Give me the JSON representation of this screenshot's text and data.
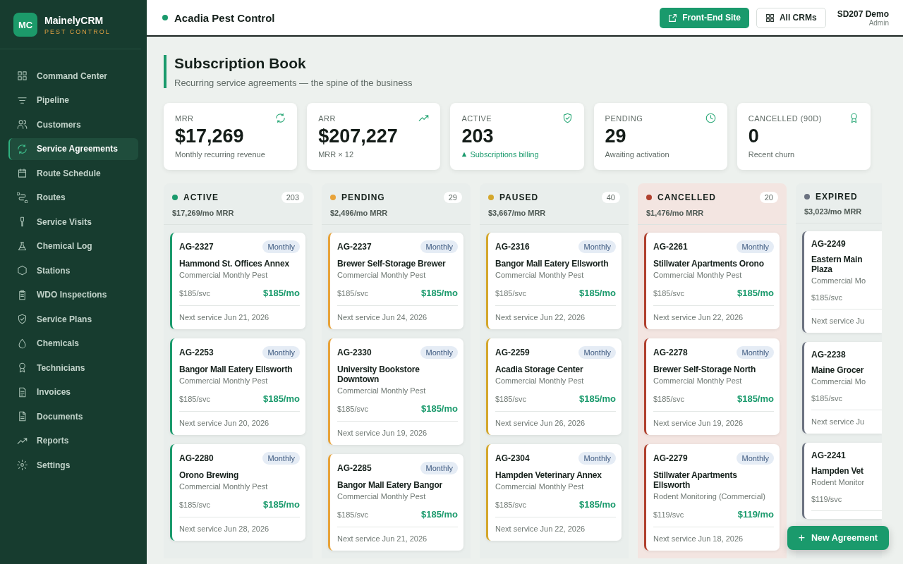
{
  "brand": {
    "logo": "MC",
    "name": "MainelyCRM",
    "tagline": "PEST CONTROL"
  },
  "sidebar": {
    "items": [
      {
        "label": "Command Center",
        "selected": false
      },
      {
        "label": "Pipeline",
        "selected": false
      },
      {
        "label": "Customers",
        "selected": false
      },
      {
        "label": "Service Agreements",
        "selected": true
      },
      {
        "label": "Route Schedule",
        "selected": false
      },
      {
        "label": "Routes",
        "selected": false
      },
      {
        "label": "Service Visits",
        "selected": false
      },
      {
        "label": "Chemical Log",
        "selected": false
      },
      {
        "label": "Stations",
        "selected": false
      },
      {
        "label": "WDO Inspections",
        "selected": false
      },
      {
        "label": "Service Plans",
        "selected": false
      },
      {
        "label": "Chemicals",
        "selected": false
      },
      {
        "label": "Technicians",
        "selected": false
      },
      {
        "label": "Invoices",
        "selected": false
      },
      {
        "label": "Documents",
        "selected": false
      },
      {
        "label": "Reports",
        "selected": false
      },
      {
        "label": "Settings",
        "selected": false
      }
    ]
  },
  "header": {
    "company": "Acadia Pest Control",
    "buttons": [
      "Front-End Site",
      "All CRMs"
    ],
    "user": {
      "name": "SD207 Demo",
      "role": "Admin"
    }
  },
  "page": {
    "title": "Subscription Book",
    "subtitle": "Recurring service agreements — the spine of the business"
  },
  "stats": [
    {
      "label": "MRR",
      "value": "$17,269",
      "note": "Monthly recurring revenue",
      "trend": false
    },
    {
      "label": "ARR",
      "value": "$207,227",
      "note": "MRR × 12",
      "trend": false
    },
    {
      "label": "ACTIVE",
      "value": "203",
      "note": "Subscriptions billing",
      "trend": true
    },
    {
      "label": "PENDING",
      "value": "29",
      "note": "Awaiting activation",
      "trend": false
    },
    {
      "label": "CANCELLED (90D)",
      "value": "0",
      "note": "Recent churn",
      "trend": false
    }
  ],
  "columns": [
    {
      "title": "ACTIVE",
      "count": "203",
      "mrr": "$17,269/mo MRR",
      "color": "#1a9a6c",
      "cut": false,
      "cards": [
        {
          "id": "AG-2327",
          "tag": "Monthly",
          "name": "Hammond St. Offices Annex",
          "plan": "Commercial Monthly Pest",
          "svc": "$185/svc",
          "mo": "$185/mo",
          "next": "Next service Jun 21, 2026"
        },
        {
          "id": "AG-2253",
          "tag": "Monthly",
          "name": "Bangor Mall Eatery Ellsworth",
          "plan": "Commercial Monthly Pest",
          "svc": "$185/svc",
          "mo": "$185/mo",
          "next": "Next service Jun 20, 2026"
        },
        {
          "id": "AG-2280",
          "tag": "Monthly",
          "name": "Orono Brewing",
          "plan": "Commercial Monthly Pest",
          "svc": "$185/svc",
          "mo": "$185/mo",
          "next": "Next service Jun 28, 2026"
        }
      ]
    },
    {
      "title": "PENDING",
      "count": "29",
      "mrr": "$2,496/mo MRR",
      "color": "#e8a33a",
      "cut": false,
      "cards": [
        {
          "id": "AG-2237",
          "tag": "Monthly",
          "name": "Brewer Self-Storage Brewer",
          "plan": "Commercial Monthly Pest",
          "svc": "$185/svc",
          "mo": "$185/mo",
          "next": "Next service Jun 24, 2026"
        },
        {
          "id": "AG-2330",
          "tag": "Monthly",
          "name": "University Bookstore Downtown",
          "plan": "Commercial Monthly Pest",
          "svc": "$185/svc",
          "mo": "$185/mo",
          "next": "Next service Jun 19, 2026"
        },
        {
          "id": "AG-2285",
          "tag": "Monthly",
          "name": "Bangor Mall Eatery Bangor",
          "plan": "Commercial Monthly Pest",
          "svc": "$185/svc",
          "mo": "$185/mo",
          "next": "Next service Jun 21, 2026"
        }
      ]
    },
    {
      "title": "PAUSED",
      "count": "40",
      "mrr": "$3,667/mo MRR",
      "color": "#d4a72c",
      "cut": false,
      "cards": [
        {
          "id": "AG-2316",
          "tag": "Monthly",
          "name": "Bangor Mall Eatery Ellsworth",
          "plan": "Commercial Monthly Pest",
          "svc": "$185/svc",
          "mo": "$185/mo",
          "next": "Next service Jun 22, 2026"
        },
        {
          "id": "AG-2259",
          "tag": "Monthly",
          "name": "Acadia Storage Center",
          "plan": "Commercial Monthly Pest",
          "svc": "$185/svc",
          "mo": "$185/mo",
          "next": "Next service Jun 26, 2026"
        },
        {
          "id": "AG-2304",
          "tag": "Monthly",
          "name": "Hampden Veterinary Annex",
          "plan": "Commercial Monthly Pest",
          "svc": "$185/svc",
          "mo": "$185/mo",
          "next": "Next service Jun 22, 2026"
        }
      ]
    },
    {
      "title": "CANCELLED",
      "count": "20",
      "mrr": "$1,476/mo MRR",
      "color": "#b0402e",
      "cut": false,
      "cards": [
        {
          "id": "AG-2261",
          "tag": "Monthly",
          "name": "Stillwater Apartments Orono",
          "plan": "Commercial Monthly Pest",
          "svc": "$185/svc",
          "mo": "$185/mo",
          "next": "Next service Jun 22, 2026"
        },
        {
          "id": "AG-2278",
          "tag": "Monthly",
          "name": "Brewer Self-Storage North",
          "plan": "Commercial Monthly Pest",
          "svc": "$185/svc",
          "mo": "$185/mo",
          "next": "Next service Jun 19, 2026"
        },
        {
          "id": "AG-2279",
          "tag": "Monthly",
          "name": "Stillwater Apartments Ellsworth",
          "plan": "Rodent Monitoring (Commercial)",
          "svc": "$119/svc",
          "mo": "$119/mo",
          "next": "Next service Jun 18, 2026"
        }
      ]
    },
    {
      "title": "EXPIRED",
      "mrr": "$3,023/mo MRR",
      "color": "#6b7280",
      "cut": true,
      "cards": [
        {
          "id": "AG-2249",
          "name": "Eastern Main\nPlaza",
          "plan": "Commercial Mo",
          "svc": "$185/svc",
          "next": "Next service Ju"
        },
        {
          "id": "AG-2238",
          "name": "Maine Grocer",
          "plan": "Commercial Mo",
          "svc": "$185/svc",
          "next": "Next service Ju"
        },
        {
          "id": "AG-2241",
          "name": "Hampden Vet",
          "plan": "Rodent Monitor",
          "svc": "$119/svc"
        }
      ]
    }
  ],
  "fab": {
    "icon": "+",
    "label": "New Agreement"
  }
}
